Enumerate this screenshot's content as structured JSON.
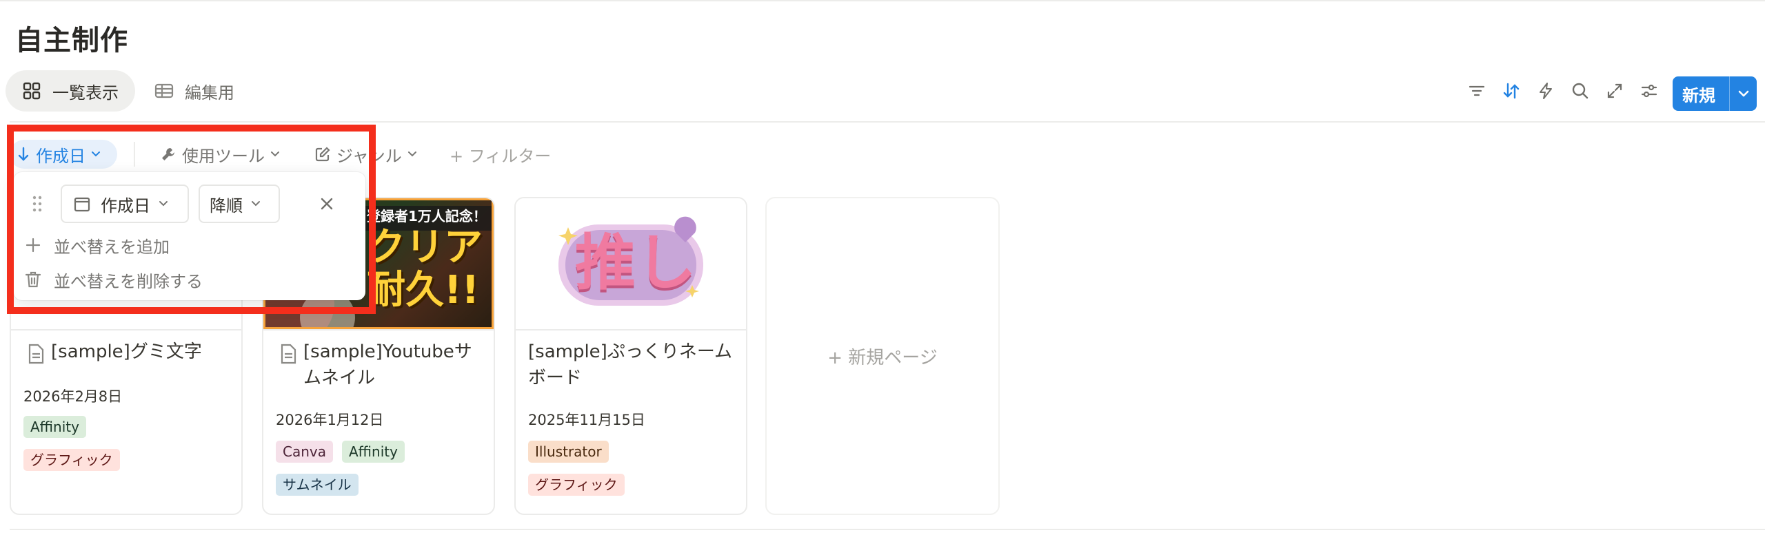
{
  "page": {
    "title": "自主制作"
  },
  "views": {
    "gallery_label": "一覧表示",
    "table_label": "編集用"
  },
  "toolbar": {
    "icons": [
      "filter-icon",
      "sort-icon",
      "automation-icon",
      "search-icon",
      "expand-icon",
      "settings-icon"
    ],
    "new_label": "新規"
  },
  "filters": {
    "sort_chip": "作成日",
    "tool_chip": "使用ツール",
    "genre_chip": "ジャンル",
    "add_filter": "+ フィルター"
  },
  "sort_popover": {
    "property": "作成日",
    "direction": "降順",
    "add_sort": "並べ替えを追加",
    "delete_sort": "並べ替えを削除する"
  },
  "cards": [
    {
      "title": "[sample]グミ文字",
      "date": "2026年2月8日",
      "tags": [
        "Affinity",
        "グラフィック"
      ]
    },
    {
      "title": "[sample]Youtubeサムネイル",
      "thumb_top_text": "登録者1万人記念！",
      "thumb_main_1": "クリア",
      "thumb_main_2": "耐久!!",
      "date": "2026年1月12日",
      "tags": [
        "Canva",
        "Affinity",
        "サムネイル"
      ]
    },
    {
      "title": "[sample]ぷっくりネームボード",
      "thumb_text": "推し",
      "date": "2025年11月15日",
      "tags": [
        "Illustrator",
        "グラフィック"
      ]
    }
  ],
  "new_page_label": "+ 新規ページ",
  "colors": {
    "accent": "#2383e2",
    "highlight_frame": "#f42e1c"
  }
}
